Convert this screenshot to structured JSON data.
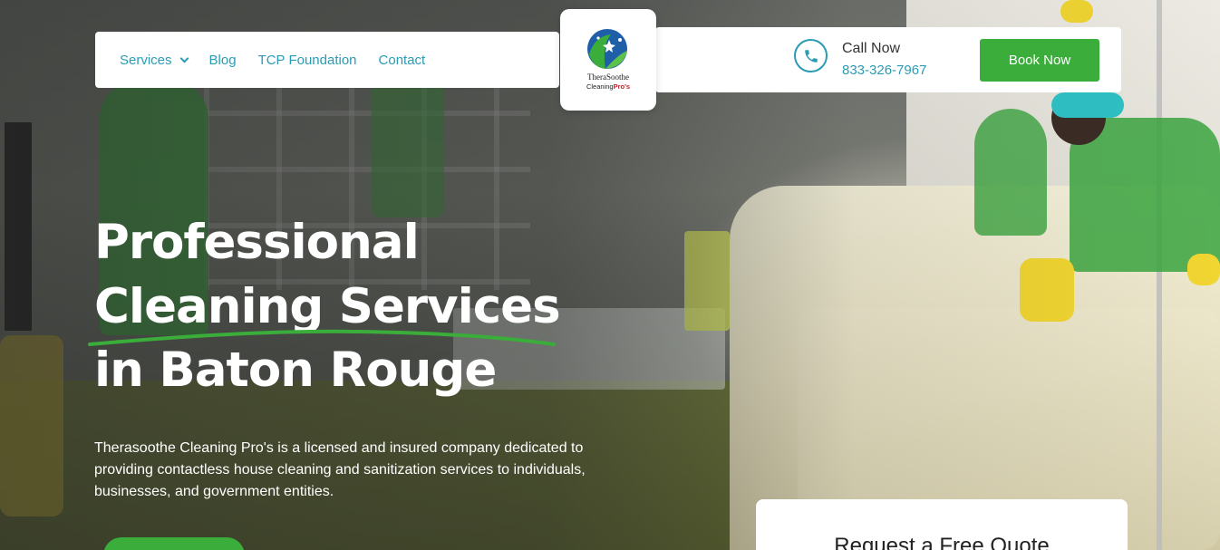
{
  "nav": {
    "links": [
      {
        "label": "Services",
        "has_dropdown": true
      },
      {
        "label": "Blog"
      },
      {
        "label": "TCP Foundation"
      },
      {
        "label": "Contact"
      }
    ]
  },
  "logo": {
    "line1": "TheraSoothe",
    "line2": "Cleaning",
    "line2_accent": "Pro's"
  },
  "contact": {
    "call_label": "Call Now",
    "phone": "833-326-7967"
  },
  "book_button": "Book Now",
  "hero": {
    "title_line1": "Professional",
    "title_line2": "Cleaning Services",
    "title_line3": "in Baton Rouge",
    "description": "Therasoothe Cleaning Pro's is a licensed and insured company dedicated to providing contactless house cleaning and sanitization services to individuals, businesses, and government entities."
  },
  "quote_card": {
    "title": "Request a Free Quote"
  },
  "colors": {
    "accent_teal": "#2a9bb5",
    "brand_green": "#3aad3a"
  },
  "icons": [
    "chevron-down-icon",
    "phone-icon"
  ]
}
